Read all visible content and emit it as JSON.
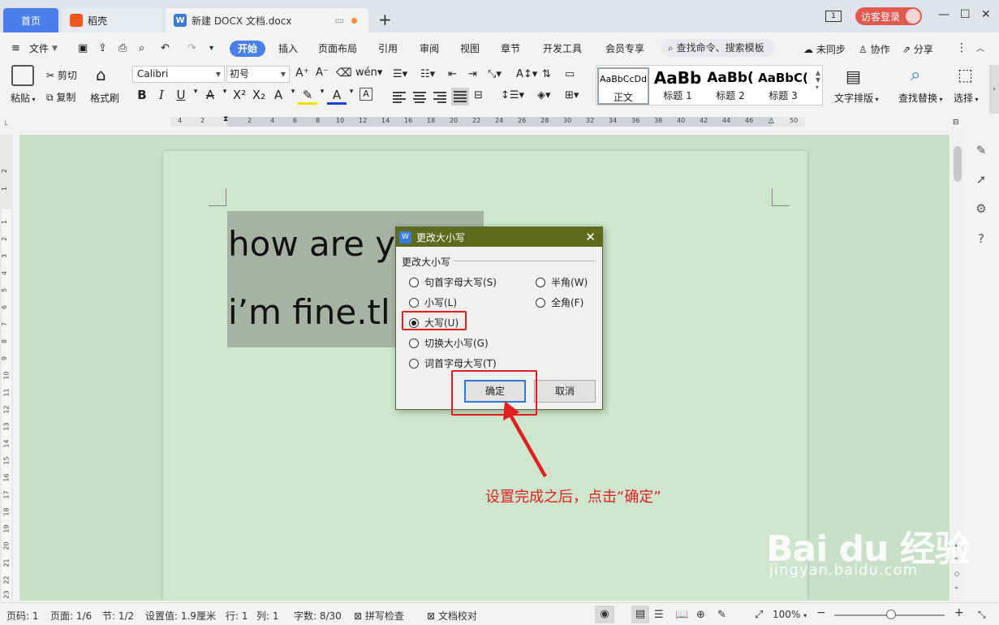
{
  "tabs": {
    "home": "首页",
    "daoke": "稻壳",
    "doc": "新建 DOCX 文档.docx",
    "add": "+"
  },
  "window": {
    "page_count_badge": "1",
    "login": "访客登录",
    "minimize": "—",
    "maximize": "☐",
    "close": "✕"
  },
  "menu": {
    "file": "文件",
    "items": [
      "开始",
      "插入",
      "页面布局",
      "引用",
      "审阅",
      "视图",
      "章节",
      "开发工具",
      "会员专享"
    ],
    "search": "查找命令、搜索模板",
    "sync": "未同步",
    "collab": "协作",
    "share": "分享"
  },
  "ribbon": {
    "paste": "粘贴",
    "cut": "剪切",
    "copy": "复制",
    "format_painter": "格式刷",
    "font_name": "Calibri",
    "font_size": "初号",
    "styles": [
      {
        "preview": "AaBbCcDd",
        "name": "正文"
      },
      {
        "preview": "AaBb",
        "name": "标题 1"
      },
      {
        "preview": "AaBb(",
        "name": "标题 2"
      },
      {
        "preview": "AaBbC(",
        "name": "标题 3"
      }
    ],
    "text_layout": "文字排版",
    "find_replace": "查找替换",
    "select": "选择"
  },
  "ruler": {
    "ticks": [
      "4",
      "2",
      "2",
      "4",
      "6",
      "8",
      "10",
      "12",
      "14",
      "16",
      "18",
      "20",
      "22",
      "24",
      "26",
      "28",
      "30",
      "32",
      "34",
      "36",
      "38",
      "40",
      "42",
      "44",
      "46",
      "50"
    ],
    "vticks": [
      "2",
      "1",
      "1",
      "2",
      "3",
      "4",
      "5",
      "6",
      "7",
      "8",
      "9",
      "10",
      "11",
      "12",
      "13",
      "14",
      "15",
      "16",
      "17",
      "18",
      "19",
      "20",
      "21",
      "22",
      "23"
    ]
  },
  "document": {
    "line1": "how are y",
    "line2": "i’m fine.tl"
  },
  "dialog": {
    "title": "更改大小写",
    "group_label": "更改大小写",
    "options": {
      "sentence_case": "句首字母大写(S)",
      "half_width": "半角(W)",
      "lowercase": "小写(L)",
      "full_width": "全角(F)",
      "uppercase": "大写(U)",
      "toggle_case": "切换大小写(G)",
      "title_case": "词首字母大写(T)"
    },
    "selected": "uppercase",
    "ok": "确定",
    "cancel": "取消"
  },
  "annotation": "设置完成之后，点击“确定”",
  "watermark": {
    "logo": "Bai du 经验",
    "url": "jingyan.baidu.com"
  },
  "status": {
    "page": "页码: 1",
    "pages": "页面: 1/6",
    "section": "节: 1/2",
    "setting": "设置值: 1.9厘米",
    "row": "行: 1",
    "col": "列: 1",
    "wordcount": "字数: 8/30",
    "spellcheck": "拼写检查",
    "proofread": "文档校对",
    "zoom": "100%"
  },
  "colors": {
    "accent": "#4a7ee8",
    "dialog_title": "#5e6b1f",
    "highlight_red": "#e02020",
    "doc_bg": "#cde6cd"
  }
}
